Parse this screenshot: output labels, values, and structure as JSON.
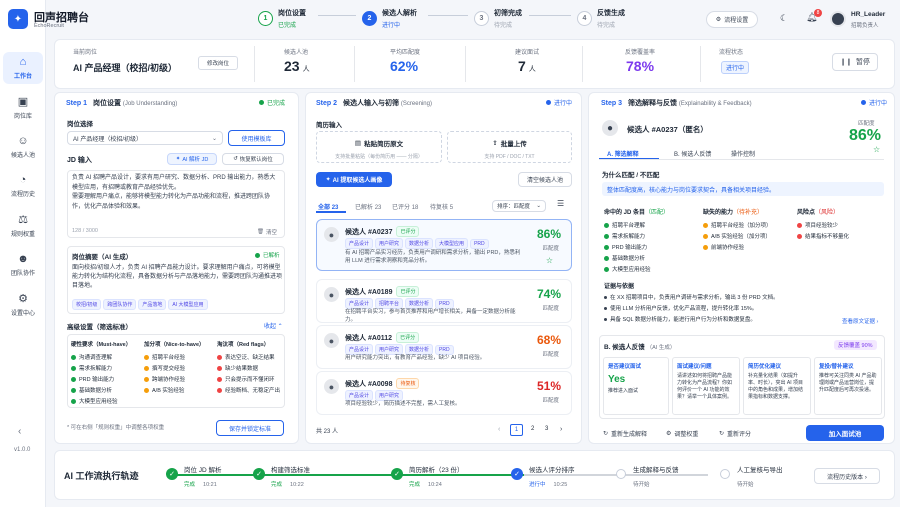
{
  "app": {
    "name": "回声招聘台",
    "sub": "EchoRecruit",
    "version": "v1.0.0"
  },
  "sidebar": {
    "items": [
      {
        "label": "工作台",
        "icon": "home-icon",
        "active": true
      },
      {
        "label": "岗位库",
        "icon": "briefcase-icon"
      },
      {
        "label": "候选人池",
        "icon": "users-icon"
      },
      {
        "label": "流程历史",
        "icon": "history-icon"
      },
      {
        "label": "规则权重",
        "icon": "scale-icon"
      },
      {
        "label": "团队协作",
        "icon": "team-icon"
      },
      {
        "label": "设置中心",
        "icon": "gear-icon"
      }
    ]
  },
  "stepper": [
    {
      "n": "1",
      "title": "岗位设置",
      "status": "已完成",
      "state": "done"
    },
    {
      "n": "2",
      "title": "候选人解析",
      "status": "进行中",
      "state": "active"
    },
    {
      "n": "3",
      "title": "初筛完成",
      "status": "待完成",
      "state": "todo"
    },
    {
      "n": "4",
      "title": "反馈生成",
      "status": "待完成",
      "state": "todo"
    }
  ],
  "header": {
    "settings_btn": "流程设置",
    "user_name": "HR_Leader",
    "user_role": "招聘负责人",
    "notif_count": "8"
  },
  "summary": {
    "pos_label": "当前岗位",
    "pos_value": "AI 产品经理（校招/初级）",
    "edit_btn": "修改岗位",
    "pool_label": "候选人池",
    "pool_value": "23",
    "pool_unit": "人",
    "match_label": "平均匹配度",
    "match_value": "62%",
    "suggest_label": "建议面试",
    "suggest_value": "7",
    "suggest_unit": "人",
    "cover_label": "反馈覆盖率",
    "cover_value": "78%",
    "state_label": "流程状态",
    "state_value": "进行中",
    "pause_btn": "暂停"
  },
  "step1": {
    "step": "Step 1",
    "title": "岗位设置",
    "en": "(Job Understanding)",
    "status": "已完成",
    "select_label": "岗位选择",
    "select_value": "AI 产品经理（校招/初级）",
    "template_btn": "使用模板库",
    "jd_label": "JD 输入",
    "ai_btn": "AI 解析 JD",
    "restore_btn": "恢复默认岗位",
    "jd_text": "负责 AI 招聘产品设计，要求有用户研究、数据分析、PRD 输出能力，熟悉大模型应用，有招聘或教育产品经验优先。\n需要理解用户痛点，能够将模型能力转化为产品功能和流程，推进跨团队协作，优化产品体验和效果。",
    "count": "128 / 3000",
    "clear_btn": "清空",
    "summary_label": "岗位摘要（AI 生成）",
    "summary_status": "已解析",
    "summary_text": "面向校招/初级人才，负责 AI 招聘产品能力设计。要求理解用户痛点，可将模型能力转化为结构化流程，具备数据分析与产品落地能力，需要跨团队沟通推进项目落地。",
    "tags": [
      "校招/初级",
      "跨团队协作",
      "产品落地",
      "AI 大模型应用"
    ],
    "adv_label": "高级设置（筛选标准）",
    "collapse": "收起 ⌃",
    "must_title": "硬性要求（Must-have）",
    "must": [
      "沟通调查理解",
      "需求拆解能力",
      "PRD 输出能力",
      "基础数据分析",
      "大模型应用经验"
    ],
    "nice_title": "加分项（Nice-to-have）",
    "nice": [
      "招聘平台经验",
      "撰写提交经验",
      "跨端协作经验",
      "A/B 实验经验"
    ],
    "red_title": "淘汰项（Red flags）",
    "red": [
      "表达空泛、缺乏结果",
      "缺少结果数据",
      "只会提示而不懂闭环",
      "经验断档、无稳定产出"
    ],
    "note": "* 可在右侧「规则权重」中调整各项权重",
    "save_btn": "保存并锁定标准"
  },
  "step2": {
    "step": "Step 2",
    "title": "候选人输入与初筛",
    "en": "(Screening)",
    "status": "进行中",
    "input_label": "简历输入",
    "paste_title": "粘贴简历原文",
    "paste_sub": "支持批量粘贴（每份简历用 —— 分隔）",
    "upload_title": "批量上传",
    "upload_sub": "支持 PDF / DOC / TXT",
    "extract_btn": "AI 提取候选人画像",
    "clear_btn": "清空候选人池",
    "filters": [
      {
        "label": "全部",
        "count": "23",
        "active": true
      },
      {
        "label": "已解析",
        "count": "23"
      },
      {
        "label": "已评分",
        "count": "18"
      },
      {
        "label": "待复核",
        "count": "5"
      }
    ],
    "sort_label": "排序：匹配度",
    "total": "共 23 人",
    "pages": [
      "1",
      "2",
      "3"
    ],
    "candidates": [
      {
        "name": "候选人 #A0237",
        "badge": "已评分",
        "badge_type": "tg",
        "tags": [
          "产品设计",
          "用户研究",
          "数据分析",
          "大模型应用",
          "PRD"
        ],
        "desc": "有 AI 招聘产品实习经历，负责用户调研和需求分析，输出 PRD，熟悉利用 LLM 进行需求洞察和竞品分析。",
        "score": "86%",
        "score_label": "匹配度",
        "color": "#16a34a"
      },
      {
        "name": "候选人 #A0189",
        "badge": "已评分",
        "badge_type": "tg",
        "tags": [
          "产品设计",
          "招聘平台",
          "数据分析",
          "PRD"
        ],
        "desc": "在招聘平台实习，参与首页推荐和用户增长相关，具备一定数据分析能力。",
        "score": "74%",
        "score_label": "匹配度",
        "color": "#16a34a"
      },
      {
        "name": "候选人 #A0112",
        "badge": "已评分",
        "badge_type": "tg",
        "tags": [
          "产品设计",
          "用户研究",
          "数据分析",
          "PRD"
        ],
        "desc": "用户研究能力突出，有教育产品经验，缺少 AI 项目经验。",
        "score": "68%",
        "score_label": "匹配度",
        "color": "#ea580c"
      },
      {
        "name": "候选人 #A0098",
        "badge": "待复核",
        "badge_type": "tor",
        "tags": [
          "产品设计",
          "用户研究"
        ],
        "desc": "项目经验较少，简历描述不完整，需人工复核。",
        "score": "51%",
        "score_label": "匹配度",
        "color": "#dc2626"
      }
    ]
  },
  "step3": {
    "step": "Step 3",
    "title": "筛选解释与反馈",
    "en": "(Explainability & Feedback)",
    "status": "进行中",
    "cand_name": "候选人 #A0237（匿名）",
    "match_label": "匹配度",
    "match_value": "86%",
    "tabs": [
      "A. 筛选解释",
      "B. 候选人反馈",
      "操作控制"
    ],
    "why_label": "为什么匹配 / 不匹配",
    "why_text": "整体匹配度高，核心能力与岗位要求契合，具备相关项目经验。",
    "col1_title": "命中的 JD 条目",
    "col1_sub": "（匹配）",
    "col1": [
      "招聘平台理解",
      "需求拆解能力",
      "PRD 输出能力",
      "基础数据分析",
      "大模型应用经验"
    ],
    "col2_title": "缺失的能力",
    "col2_sub": "（待补充）",
    "col2": [
      "招聘平台经验（加分项）",
      "A/B 实验经验（加分项）",
      "前端协作经验"
    ],
    "col3_title": "风险点",
    "col3_sub": "（风险）",
    "col3": [
      "项目经验较少",
      "结果指标不够量化"
    ],
    "evid_label": "证据与依据",
    "evid": [
      "在 XX 招聘项目中，负责用户调研与需求分析，输出 3 份 PRD 文档。",
      "使用 LLM 分析用户反馈，优化产品流程，提升转化率 15%。",
      "具备 SQL 数据分析能力，能进行用户行为分析和数据复盘。"
    ],
    "evid_link": "查看原文证据 ›",
    "fb_label": "B. 候选人反馈",
    "fb_sub": "（AI 生成）",
    "fb_badge": "反馈覆盖 90%",
    "fb1_title": "是否建议面试",
    "fb1_value": "Yes",
    "fb1_text": "推荐进入面试",
    "fb2_title": "面试建议/问题",
    "fb2_text": "请讲述如何将招聘产品能力转化为产品流程？你如何评价一个 AI 功能的效果？请举一个具体案例。",
    "fb3_title": "简历优化建议",
    "fb3_text": "补充量化结果（如提升率、时长），突出 AI 项目中的角色和成果，增加结果指标和数据支撑。",
    "fb4_title": "复投/替补建议",
    "fb4_text": "推荐可关注同类 AI 产品助理岗或产品运营岗位，提升匹配度后可再次投递。",
    "regen_btn": "重新生成解释",
    "adjust_btn": "调整权重",
    "rescore_btn": "重新评分",
    "interview_btn": "加入面试池"
  },
  "timeline": {
    "title": "AI 工作流执行轨迹",
    "history_btn": "流程历史版本 ›",
    "nodes": [
      {
        "label": "岗位 JD 解析",
        "status": "完成",
        "time": "10:21",
        "state": "done"
      },
      {
        "label": "构建筛选标准",
        "status": "完成",
        "time": "10:22",
        "state": "done"
      },
      {
        "label": "简历解析（23 份）",
        "status": "完成",
        "time": "10:24",
        "state": "done"
      },
      {
        "label": "候选人评分排序",
        "status": "进行中",
        "time": "10:25",
        "state": "active"
      },
      {
        "label": "生成解释与反馈",
        "status": "待开始",
        "time": "",
        "state": "todo"
      },
      {
        "label": "人工复核与导出",
        "status": "待开始",
        "time": "",
        "state": "todo"
      }
    ]
  },
  "colors": {
    "primary": "#2563eb",
    "success": "#16a34a",
    "warn": "#ea580c",
    "danger": "#dc2626",
    "purple": "#7c3aed"
  }
}
